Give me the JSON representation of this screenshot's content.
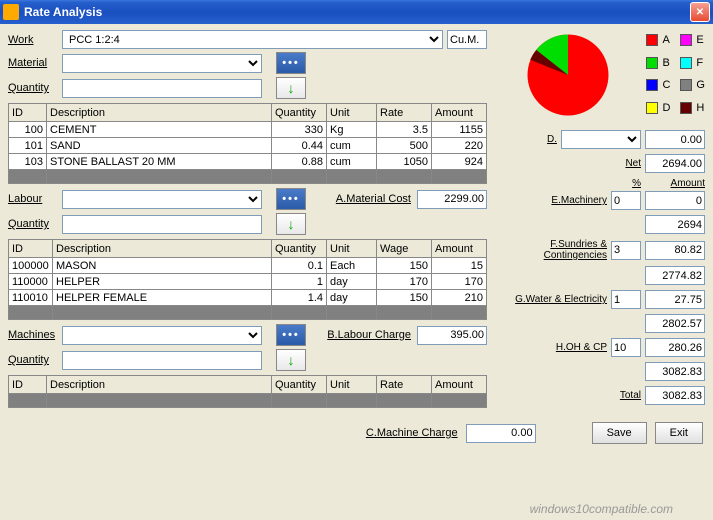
{
  "window": {
    "title": "Rate Analysis"
  },
  "work": {
    "label": "Work",
    "value": "PCC 1:2:4",
    "unit": "Cu.M."
  },
  "material": {
    "label": "Material",
    "qty_label": "Quantity"
  },
  "labour": {
    "label": "Labour",
    "qty_label": "Quantity"
  },
  "machines": {
    "label": "Machines",
    "qty_label": "Quantity"
  },
  "matCols": [
    "ID",
    "Description",
    "Quantity",
    "Unit",
    "Rate",
    "Amount"
  ],
  "matRows": [
    {
      "id": "100",
      "desc": "CEMENT",
      "qty": "330",
      "unit": "Kg",
      "rate": "3.5",
      "amt": "1155"
    },
    {
      "id": "101",
      "desc": "SAND",
      "qty": "0.44",
      "unit": "cum",
      "rate": "500",
      "amt": "220"
    },
    {
      "id": "103",
      "desc": "STONE BALLAST 20 MM",
      "qty": "0.88",
      "unit": "cum",
      "rate": "1050",
      "amt": "924"
    }
  ],
  "labCols": [
    "ID",
    "Description",
    "Quantity",
    "Unit",
    "Wage",
    "Amount"
  ],
  "labRows": [
    {
      "id": "100000",
      "desc": "MASON",
      "qty": "0.1",
      "unit": "Each",
      "rate": "150",
      "amt": "15"
    },
    {
      "id": "110000",
      "desc": "HELPER",
      "qty": "1",
      "unit": "day",
      "rate": "170",
      "amt": "170"
    },
    {
      "id": "110010",
      "desc": "HELPER FEMALE",
      "qty": "1.4",
      "unit": "day",
      "rate": "150",
      "amt": "210"
    }
  ],
  "macCols": [
    "ID",
    "Description",
    "Quantity",
    "Unit",
    "Rate",
    "Amount"
  ],
  "costA": {
    "label": "A.Material Cost",
    "val": "2299.00"
  },
  "costB": {
    "label": "B.Labour Charge",
    "val": "395.00"
  },
  "costC": {
    "label": "C.Machine Charge",
    "val": "0.00"
  },
  "legend": [
    "A",
    "B",
    "C",
    "D",
    "E",
    "F",
    "G",
    "H"
  ],
  "legendColors": [
    "#ff0000",
    "#00dd00",
    "#0000ff",
    "#ffff00",
    "#ff00ff",
    "#00ffff",
    "#808080",
    "#660000"
  ],
  "D": {
    "label": "D.",
    "val": "0.00"
  },
  "net": {
    "label": "Net",
    "val": "2694.00"
  },
  "hdr": {
    "pc": "%",
    "amt": "Amount"
  },
  "E": {
    "label": "E.Machinery",
    "pc": "0",
    "amt": "0"
  },
  "sub1": "2694",
  "F": {
    "label": "F.Sundries & Contingencies",
    "pc": "3",
    "amt": "80.82"
  },
  "sub2": "2774.82",
  "G": {
    "label": "G.Water & Electricity",
    "pc": "1",
    "amt": "27.75"
  },
  "sub3": "2802.57",
  "H": {
    "label": "H.OH & CP",
    "pc": "10",
    "amt": "280.26"
  },
  "sub4": "3082.83",
  "total": {
    "label": "Total",
    "val": "3082.83"
  },
  "buttons": {
    "save": "Save",
    "exit": "Exit"
  },
  "watermark": "windows10compatible.com",
  "chart_data": {
    "type": "pie",
    "categories": [
      "A",
      "B",
      "C",
      "D",
      "E",
      "F",
      "G",
      "H"
    ],
    "values": [
      2299,
      395,
      0,
      0,
      0,
      0,
      0,
      0
    ],
    "colors": [
      "#ff0000",
      "#00dd00",
      "#0000ff",
      "#ffff00",
      "#ff00ff",
      "#00ffff",
      "#808080",
      "#660000"
    ],
    "title": ""
  }
}
